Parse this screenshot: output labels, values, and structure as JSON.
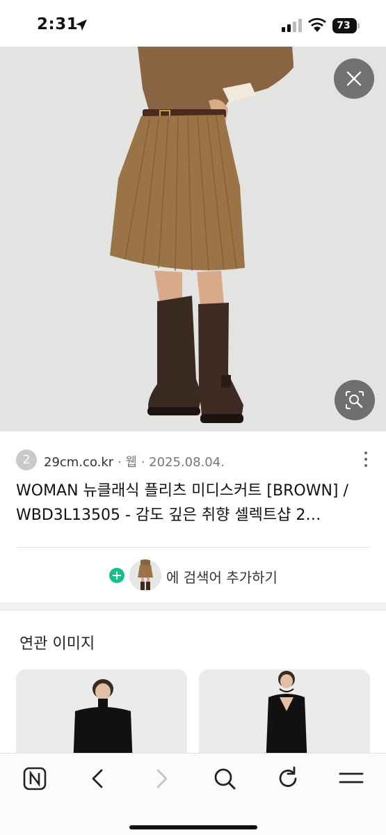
{
  "status_bar": {
    "time": "2:31",
    "battery": "73"
  },
  "result": {
    "favicon_letter": "2",
    "site": "29cm.co.kr",
    "type": "웹",
    "date": "2025.08.04.",
    "title": "WOMAN 뉴클래식 플리츠 미디스커트 [BROWN] / WBD3L13505 - 감도 깊은 취향 셀렉트샵 2…"
  },
  "add_search": {
    "label": "에 검색어 추가하기"
  },
  "related": {
    "title": "연관 이미지"
  },
  "icons": {
    "close": "close-icon",
    "lens": "image-search-icon",
    "more": "more-vertical-icon",
    "plus": "plus-icon",
    "home": "naver-home-icon",
    "back": "chevron-left-icon",
    "forward": "chevron-right-icon",
    "search": "search-icon",
    "refresh": "refresh-icon",
    "menu": "menu-icon"
  },
  "colors": {
    "accent_green": "#16c08a",
    "skirt_brown": "#9a7447"
  }
}
